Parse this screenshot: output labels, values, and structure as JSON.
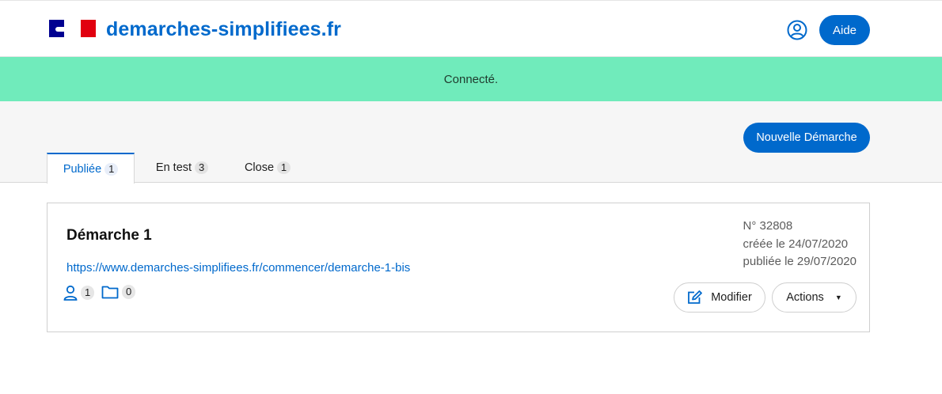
{
  "header": {
    "brand": "demarches-simplifiees.fr",
    "aide_label": "Aide"
  },
  "flash": {
    "message": "Connecté."
  },
  "toolbar": {
    "new_label": "Nouvelle Démarche"
  },
  "tabs": [
    {
      "label": "Publiée",
      "count": "1"
    },
    {
      "label": "En test",
      "count": "3"
    },
    {
      "label": "Close",
      "count": "1"
    }
  ],
  "card": {
    "title": "Démarche 1",
    "link": "https://www.demarches-simplifiees.fr/commencer/demarche-1-bis",
    "instructeurs_count": "1",
    "dossiers_count": "0",
    "numero": "N° 32808",
    "created": "créée le 24/07/2020",
    "published": "publiée le 29/07/2020",
    "modifier_label": "Modifier",
    "actions_label": "Actions"
  },
  "colors": {
    "primary": "#0069cc",
    "flash_bg": "#70ebbb",
    "toolbar_bg": "#f6f6f6"
  },
  "icons": [
    "marianne-logo-icon",
    "user-circle-icon",
    "person-icon",
    "folder-icon",
    "edit-icon",
    "caret-down-icon"
  ]
}
